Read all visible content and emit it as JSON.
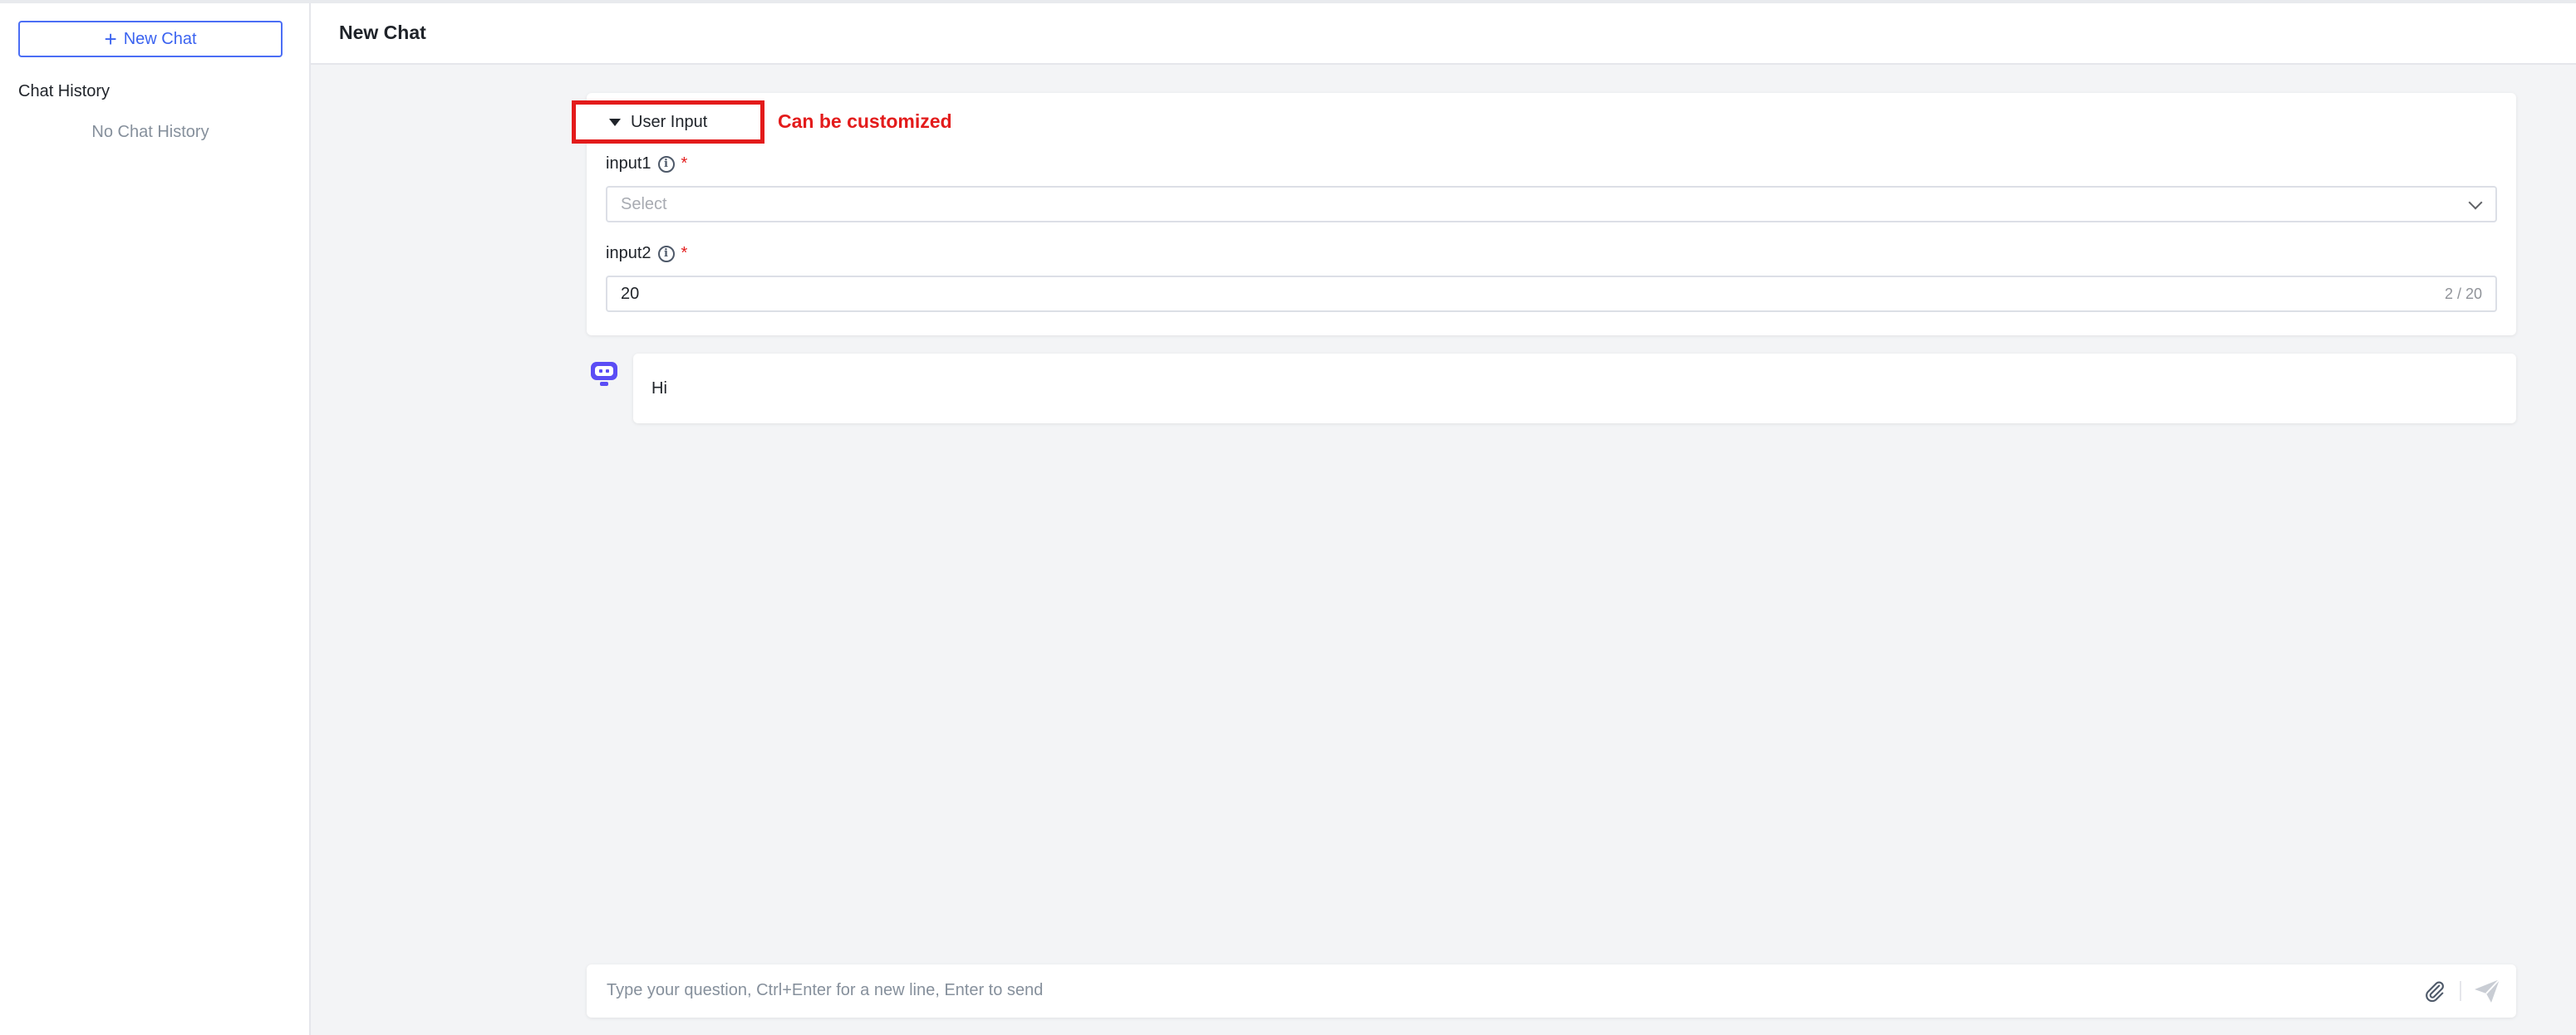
{
  "sidebar": {
    "new_chat_label": "New Chat",
    "history_title": "Chat History",
    "empty_text": "No Chat History"
  },
  "header": {
    "title": "New Chat"
  },
  "form": {
    "toggle_label": "User Input",
    "annotation": "Can be customized",
    "fields": [
      {
        "label": "input1",
        "required_mark": "*",
        "type": "select",
        "placeholder": "Select",
        "value": ""
      },
      {
        "label": "input2",
        "required_mark": "*",
        "type": "text",
        "value": "20",
        "counter": "2 / 20"
      }
    ]
  },
  "messages": [
    {
      "role": "bot",
      "text": "Hi"
    }
  ],
  "composer": {
    "placeholder": "Type your question, Ctrl+Enter for a new line, Enter to send"
  },
  "colors": {
    "accent": "#3b63f0",
    "annotation_red": "#e31b1b",
    "bot_avatar": "#5b4df5"
  }
}
